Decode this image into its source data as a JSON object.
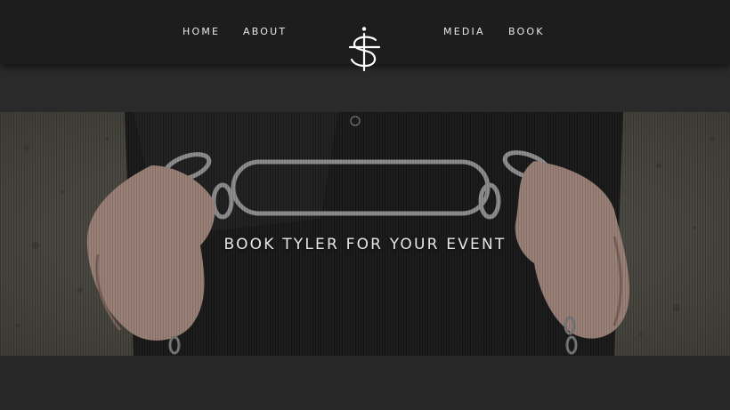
{
  "nav": {
    "home": "HOME",
    "about": "ABOUT",
    "media": "MEDIA",
    "book": "BOOK",
    "logo_icon": "ts-monogram-icon"
  },
  "hero": {
    "title": "BOOK TYLER FOR YOUR EVENT",
    "image": "handcuffed-hands-photo"
  },
  "colors": {
    "nav_bg": "#1d1d1d",
    "page_bg": "#2a2a2a",
    "text": "#e8e8e8"
  }
}
